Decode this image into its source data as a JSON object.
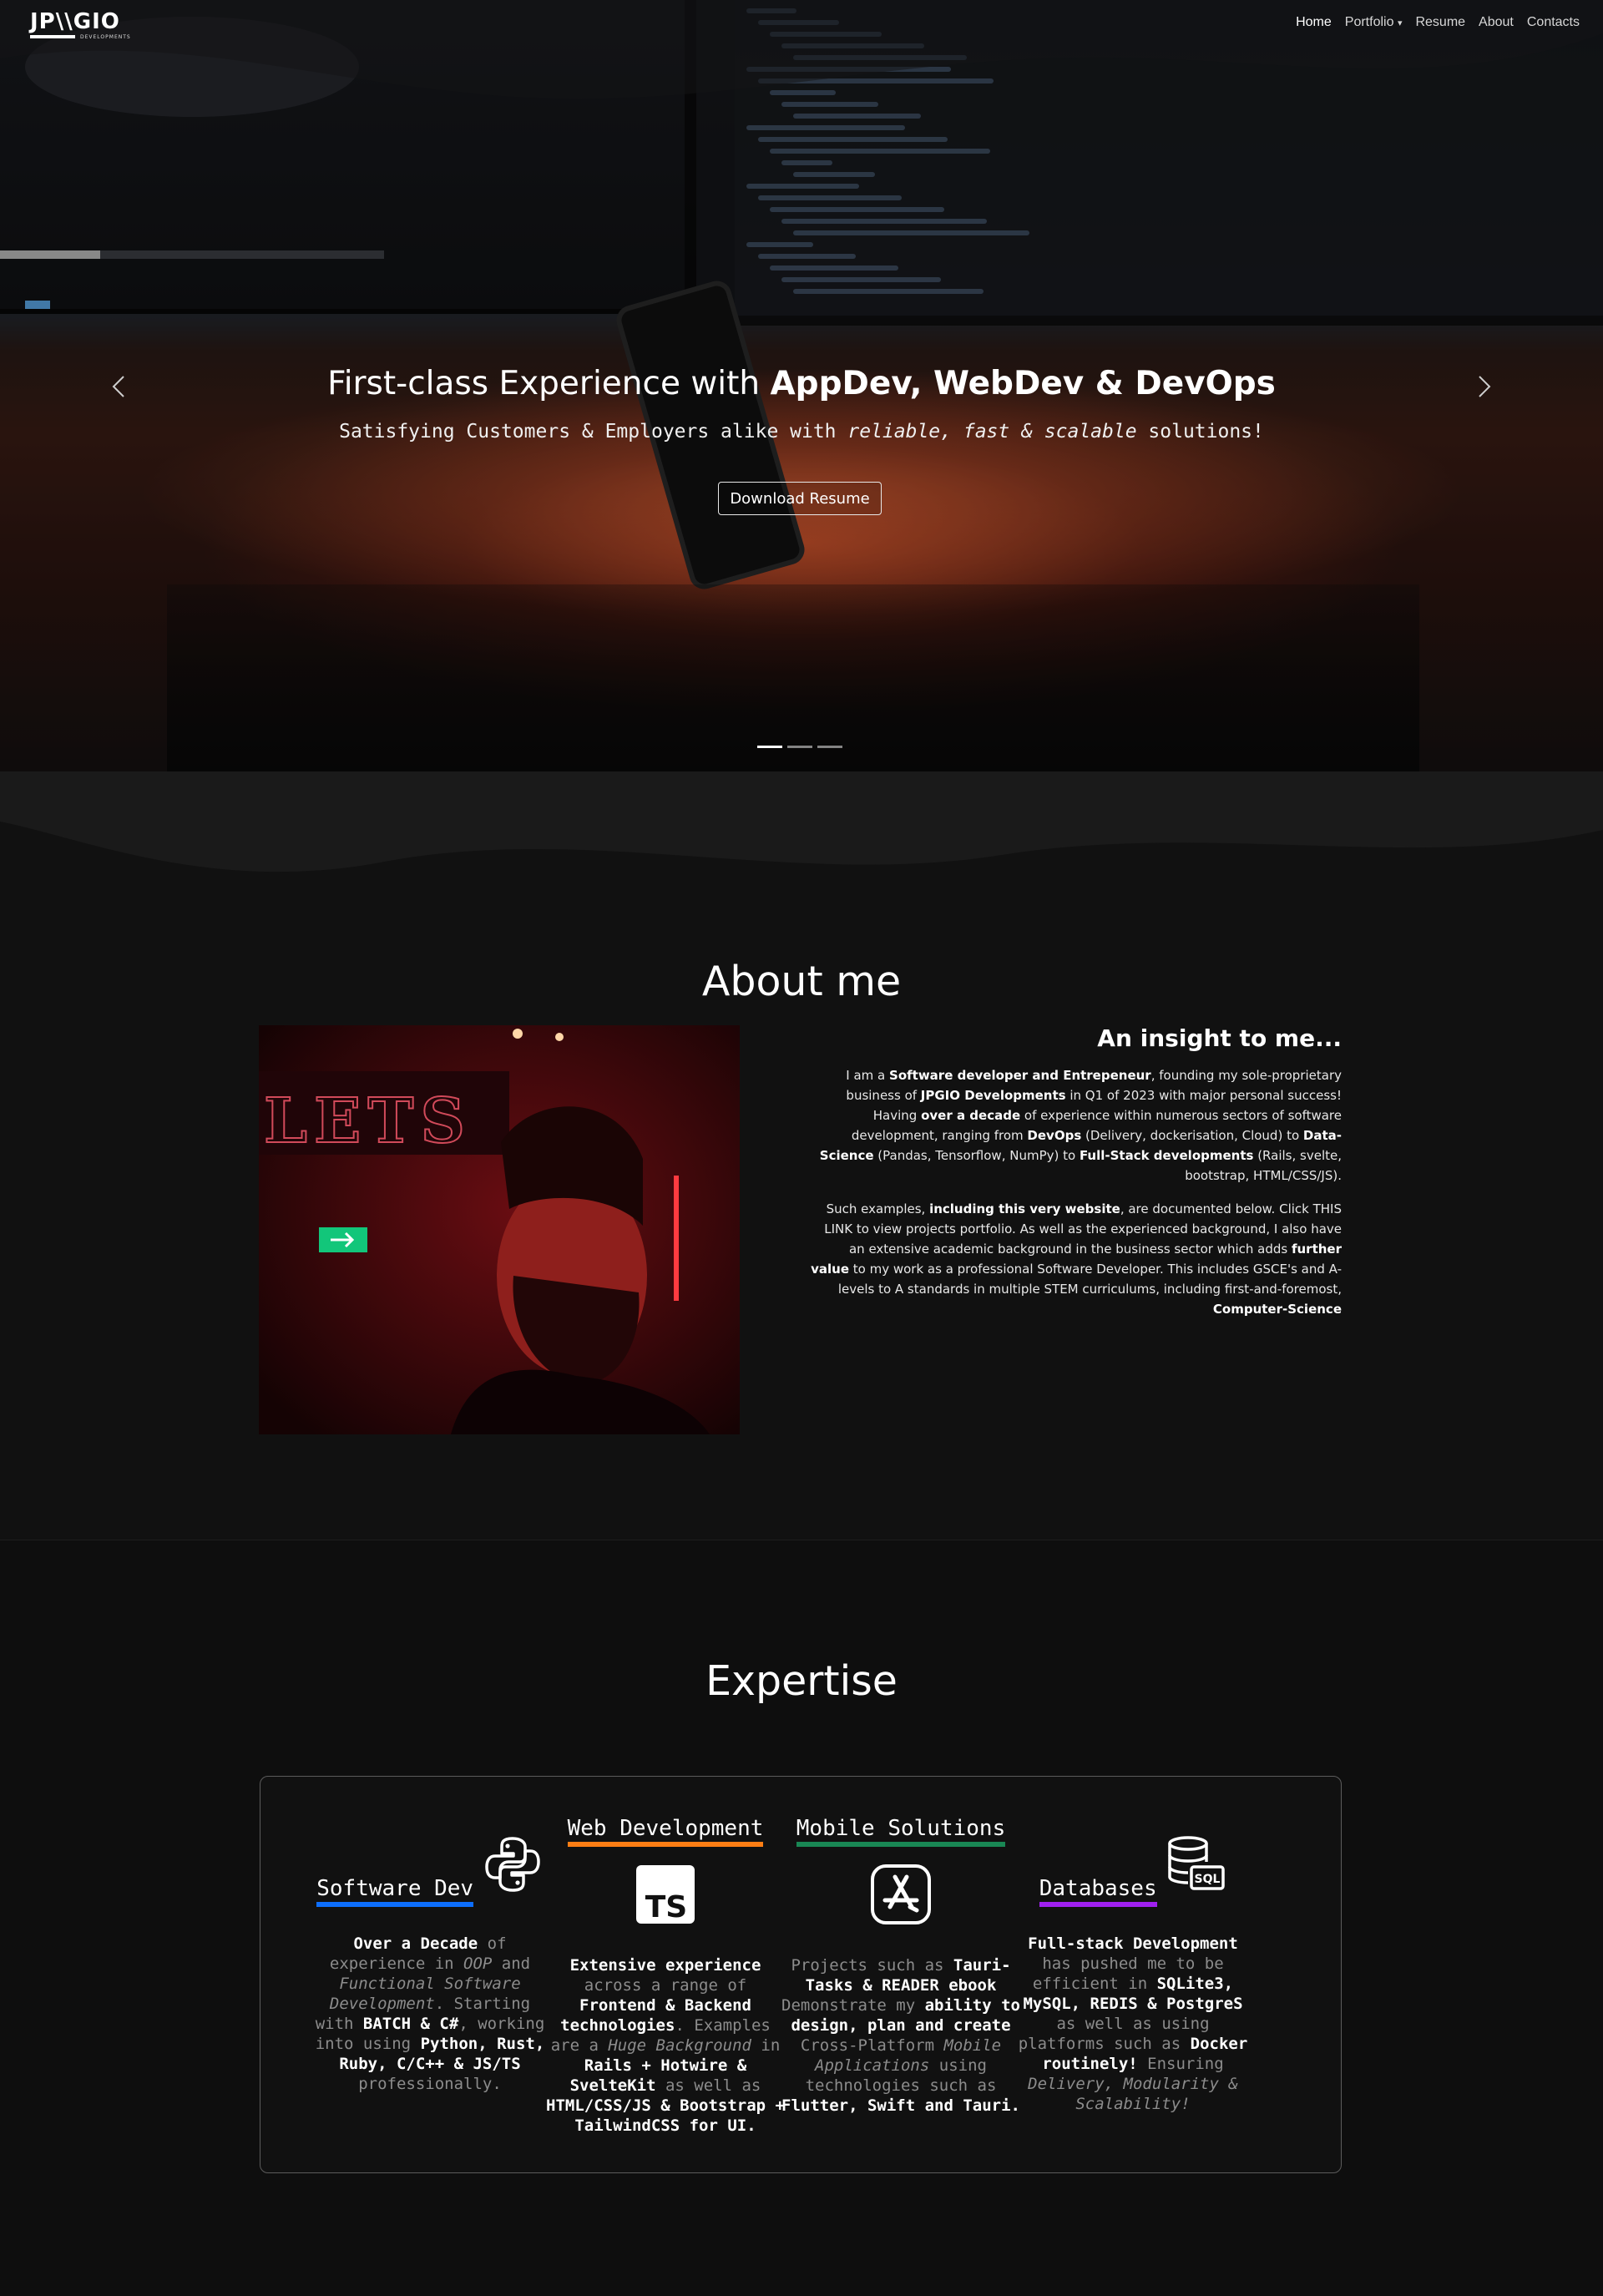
{
  "nav": {
    "logo_text": "JP\\\\GIO",
    "logo_sub": "DEVELOPMENTS",
    "links": [
      "Home",
      "Portfolio",
      "Resume",
      "About",
      "Contacts"
    ],
    "portfolio_caret": "▾"
  },
  "hero": {
    "title_plain": "First-class Experience with ",
    "title_bold": "AppDev, WebDev & DevOps",
    "subtitle_pre": "Satisfying Customers & Employers alike with ",
    "subtitle_italic": "reliable, fast & scalable",
    "subtitle_post": " solutions!",
    "button_label": "Download Resume",
    "slides_count": 3,
    "active_slide": 1
  },
  "about": {
    "heading": "About me",
    "subheading": "An insight to me...",
    "p1": [
      {
        "t": "I am a "
      },
      {
        "b": "Software developer and Entrepeneur"
      },
      {
        "t": ", founding my sole-proprietary business of "
      },
      {
        "b": "JPGIO Developments"
      },
      {
        "t": " in Q1 of 2023 with major personal success! Having "
      },
      {
        "b": "over a decade"
      },
      {
        "t": " of experience within numerous sectors of software development, ranging from "
      },
      {
        "b": "DevOps"
      },
      {
        "t": " (Delivery, dockerisation, Cloud) to "
      },
      {
        "b": "Data-Science"
      },
      {
        "t": " (Pandas, Tensorflow, NumPy) to "
      },
      {
        "b": "Full-Stack developments"
      },
      {
        "t": " (Rails, svelte, bootstrap, HTML/CSS/JS)."
      }
    ],
    "p2": [
      {
        "t": "Such examples, "
      },
      {
        "b": "including this very website"
      },
      {
        "t": ", are documented below. Click THIS LINK to view projects portfolio. As well as the experienced background, I also have an extensive academic background in the business sector which adds "
      },
      {
        "b": "further value"
      },
      {
        "t": " to my work as a professional Software Developer. This includes GSCE's and A-levels to A standards in multiple STEM curriculums, including first-and-foremost, "
      },
      {
        "b": "Computer-Science"
      }
    ],
    "sign_text": "LETS"
  },
  "expertise": {
    "heading": "Expertise",
    "columns": [
      {
        "title": "Software Dev",
        "icon": "python-icon",
        "underline": "#0d6efd",
        "desc": [
          {
            "b": "Over a Decade"
          },
          {
            "t": " of experience in "
          },
          {
            "i": "OOP"
          },
          {
            "t": " and "
          },
          {
            "i": "Functional Software Development"
          },
          {
            "t": ". Starting with "
          },
          {
            "b": "BATCH & C#"
          },
          {
            "t": ", working into using "
          },
          {
            "b": "Python, Rust, Ruby, C/C++ & JS/TS"
          },
          {
            "t": " professionally."
          }
        ]
      },
      {
        "title": "Web Development",
        "icon": "typescript-icon",
        "underline": "#fd7e14",
        "desc": [
          {
            "b": "Extensive experience"
          },
          {
            "t": " across a range of "
          },
          {
            "b": "Frontend & Backend technologies"
          },
          {
            "t": ". Examples are a "
          },
          {
            "i": "Huge Background"
          },
          {
            "t": " in "
          },
          {
            "b": "Rails + Hotwire & SvelteKit"
          },
          {
            "t": " as well as "
          },
          {
            "b": "HTML/CSS/JS & Bootstrap + TailwindCSS for UI."
          }
        ]
      },
      {
        "title": "Mobile Solutions",
        "icon": "app-store-icon",
        "underline": "#198754",
        "desc": [
          {
            "t": "Projects such as "
          },
          {
            "b": "Tauri-Tasks & READER ebook"
          },
          {
            "t": " Demonstrate my "
          },
          {
            "b": "ability to design, plan and create"
          },
          {
            "t": " Cross-Platform "
          },
          {
            "i": "Mobile Applications"
          },
          {
            "t": " using technologies such as "
          },
          {
            "b": "Flutter, Swift and Tauri."
          }
        ]
      },
      {
        "title": "Databases",
        "icon": "sql-database-icon",
        "underline": "#a020f0",
        "desc": [
          {
            "b": "Full-stack Development"
          },
          {
            "t": " has pushed me to be efficient in "
          },
          {
            "b": "SQLite3, MySQL, REDIS & PostgreS"
          },
          {
            "t": " as well as using platforms such as "
          },
          {
            "b": "Docker routinely!"
          },
          {
            "t": " Ensuring "
          },
          {
            "i": "Delivery, Modularity & Scalability!"
          }
        ]
      }
    ],
    "sql_badge": "SQL",
    "ts_badge": "TS"
  }
}
